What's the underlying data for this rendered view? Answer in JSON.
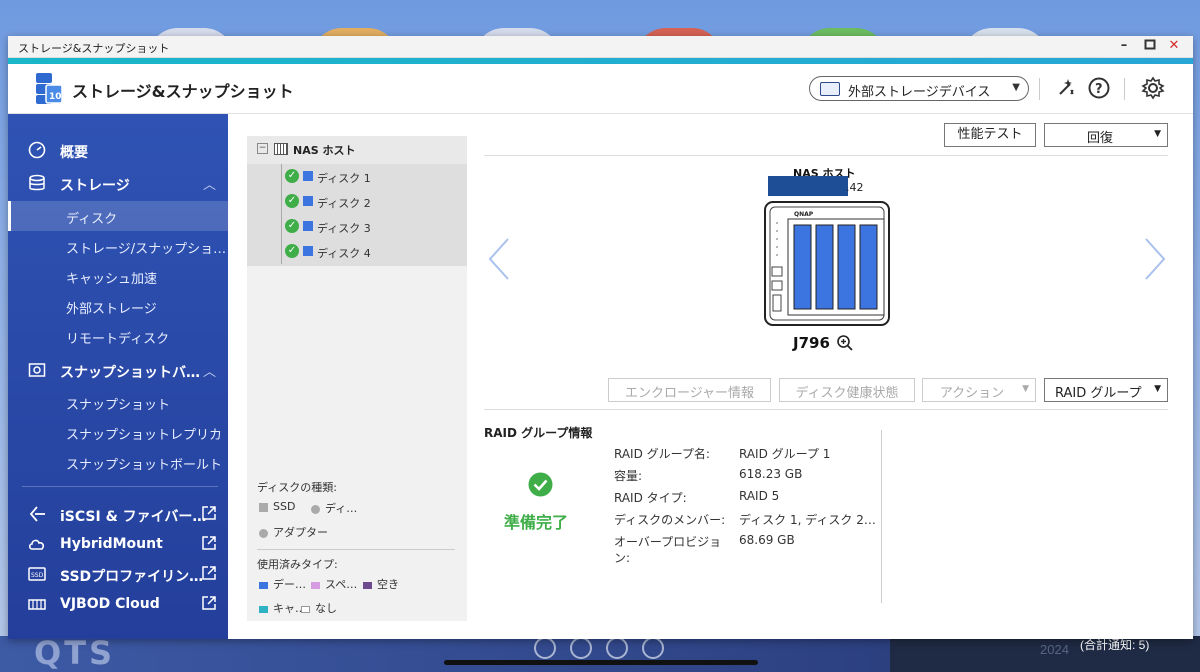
{
  "window": {
    "title": "ストレージ&スナップショット"
  },
  "header": {
    "app_title": "ストレージ&スナップショット",
    "external_device_label": "外部ストレージデバイス"
  },
  "sidebar": {
    "overview": "概要",
    "storage": "ストレージ",
    "storage_items": [
      "ディスク",
      "ストレージ/スナップショ…",
      "キャッシュ加速",
      "外部ストレージ",
      "リモートディスク"
    ],
    "snapshot_backup": "スナップショットバ…",
    "snapshot_items": [
      "スナップショット",
      "スナップショットレプリカ",
      "スナップショットボールト"
    ],
    "links": [
      "iSCSI & ファイバー…",
      "HybridMount",
      "SSDプロファイリン…",
      "VJBOD Cloud"
    ]
  },
  "tree": {
    "host_label": "NAS ホスト",
    "disks": [
      "ディスク 1",
      "ディスク 2",
      "ディスク 3",
      "ディスク 4"
    ]
  },
  "legend": {
    "disk_type_title": "ディスクの種類:",
    "ssd": "SSD",
    "other": "ディ…",
    "adapter": "アダプター",
    "used_type_title": "使用済みタイプ:",
    "data": "デー…",
    "spare": "スペ…",
    "free": "空き",
    "cache": "キャ…",
    "none": "なし"
  },
  "toolbar": {
    "perf_test": "性能テスト",
    "recover": "回復",
    "enclosure_info": "エンクロージャー情報",
    "disk_health": "ディスク健康状態",
    "action": "アクション",
    "raid_group": "RAID グループ"
  },
  "device": {
    "host_label": "NAS ホスト",
    "ip_suffix": ".42",
    "model": "J796",
    "brand": "QNAP"
  },
  "raid_info": {
    "section_title": "RAID グループ情報",
    "status": "準備完了",
    "rows": [
      {
        "label": "RAID グループ名:",
        "value": "RAID グループ 1"
      },
      {
        "label": "容量:",
        "value": "618.23 GB"
      },
      {
        "label": "RAID タイプ:",
        "value": "RAID 5"
      },
      {
        "label": "ディスクのメンバー:",
        "value": "ディスク 1, ディスク 2…"
      },
      {
        "label": "オーバープロビジョ",
        "value": "68.69 GB"
      },
      {
        "label": "ン:",
        "value": ""
      }
    ]
  },
  "desktop": {
    "logo": "QTS",
    "notification_count": "(合計通知: 5)",
    "date": "2024"
  },
  "colors": {
    "accent": "#19b7c9",
    "sidebar": "#2f53b4",
    "status_ok": "#3fae49",
    "disk_blue": "#3c74e0"
  }
}
